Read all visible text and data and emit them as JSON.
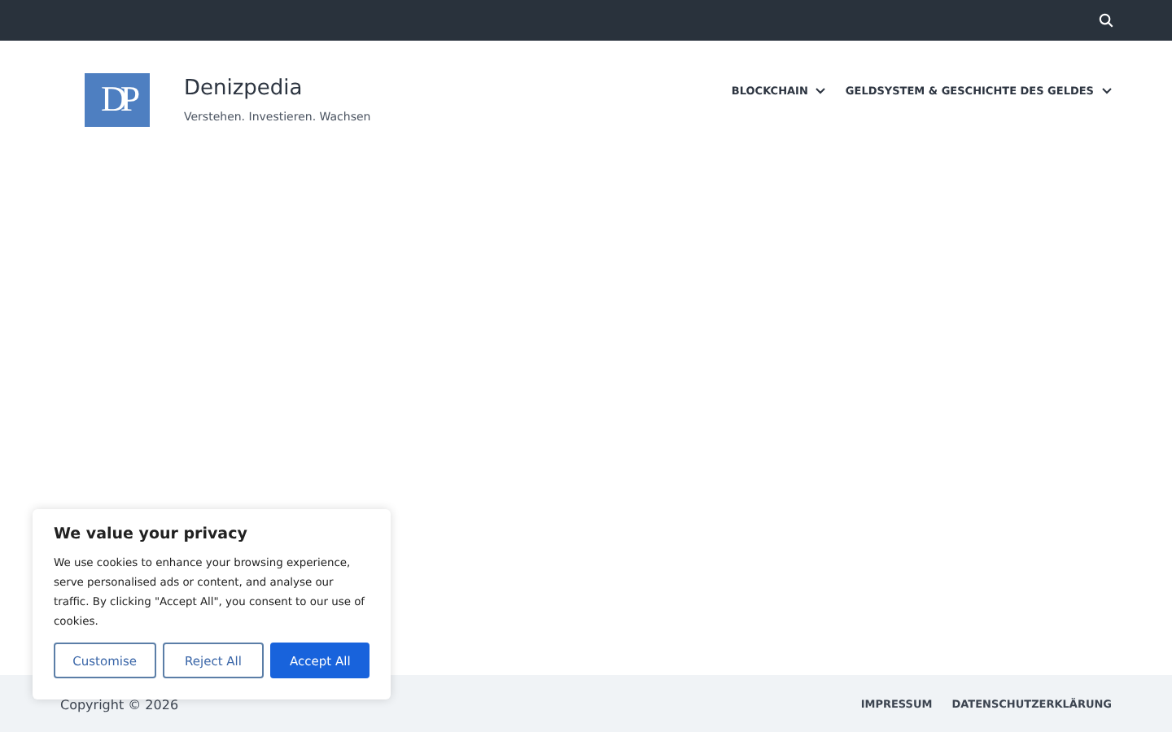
{
  "topbar": {
    "search_icon": true
  },
  "header": {
    "logo": "DP",
    "site_title": "Denizpedia",
    "tagline": "Verstehen. Investieren. Wachsen",
    "nav": [
      {
        "label": "BLOCKCHAIN",
        "has_submenu": true
      },
      {
        "label": "GELDSYSTEM & GESCHICHTE DES GELDES",
        "has_submenu": true
      }
    ]
  },
  "footer": {
    "copyright": "Copyright © 2026",
    "links": [
      "IMPRESSUM",
      "DATENSCHUTZERKLÄRUNG"
    ]
  },
  "cookie_banner": {
    "title": "We value your privacy",
    "text": "We use cookies to enhance your browsing experience, serve personalised ads or content, and analyse our traffic. By clicking \"Accept All\", you consent to our use of cookies.",
    "buttons": [
      {
        "label": "Customise",
        "kind": "outline"
      },
      {
        "label": "Reject All",
        "kind": "outline"
      },
      {
        "label": "Accept All",
        "kind": "primary"
      }
    ]
  }
}
